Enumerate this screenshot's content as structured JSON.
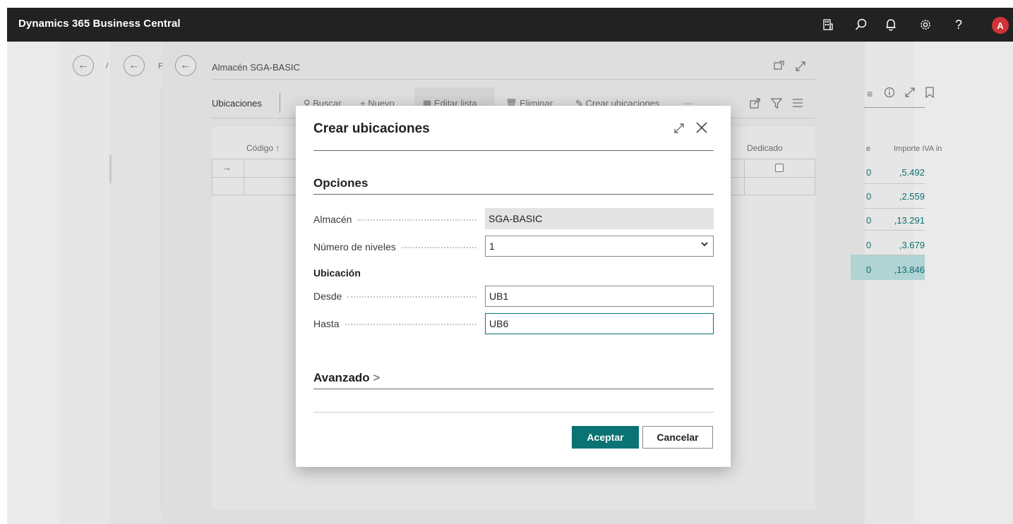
{
  "app": {
    "title": "Dynamics 365 Business Central",
    "avatar_initial": "A"
  },
  "background": {
    "page_title": "Almacén SGA-BASIC",
    "actions": {
      "tab": "Ubicaciones",
      "search": "Buscar",
      "new": "Nuevo",
      "edit_list": "Editar lista",
      "delete": "Eliminar",
      "create_bins": "Crear ubicaciones",
      "more": "···"
    },
    "columns": {
      "code": "Código",
      "code_sort": "↑",
      "dedicated": "Dedicado",
      "vat_amount": "Importe IVA in",
      "partial": "e"
    },
    "row_arrow": "→",
    "amounts": [
      "5.492,",
      "2.559,",
      "13.291,",
      "3.679,",
      "13.846,"
    ],
    "amount_prefix": "0"
  },
  "dialog": {
    "title": "Crear ubicaciones",
    "options_section": "Opciones",
    "warehouse_label": "Almacén",
    "warehouse_value": "SGA-BASIC",
    "levels_label": "Número de niveles",
    "levels_value": "1",
    "bin_subheading": "Ubicación",
    "from_label": "Desde",
    "from_value": "UB1",
    "to_label": "Hasta",
    "to_value": "UB6",
    "advanced_section": "Avanzado",
    "advanced_chevron": ">",
    "ok_label": "Aceptar",
    "cancel_label": "Cancelar"
  },
  "colors": {
    "accent": "#0b7373",
    "topbar": "#222222",
    "avatar": "#d13438"
  }
}
